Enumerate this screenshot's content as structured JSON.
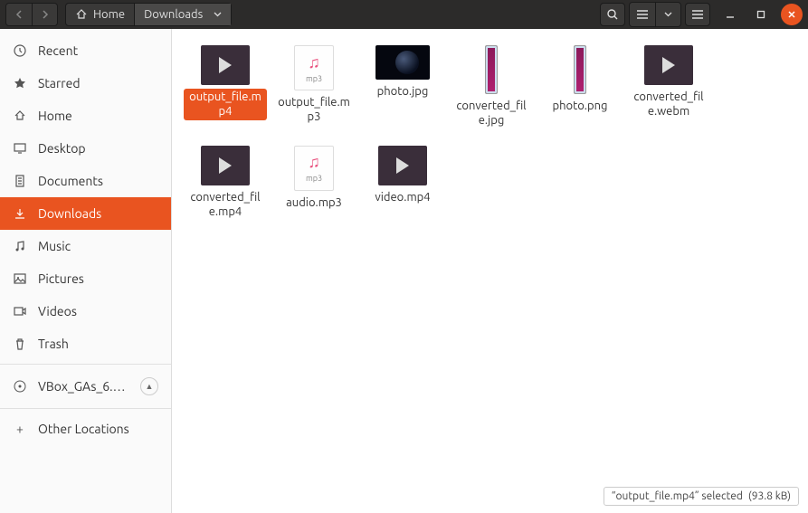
{
  "breadcrumb": {
    "home": "Home",
    "current": "Downloads"
  },
  "sidebar": {
    "items": [
      {
        "label": "Recent",
        "icon": "clock"
      },
      {
        "label": "Starred",
        "icon": "star"
      },
      {
        "label": "Home",
        "icon": "home"
      },
      {
        "label": "Desktop",
        "icon": "desktop"
      },
      {
        "label": "Documents",
        "icon": "documents"
      },
      {
        "label": "Downloads",
        "icon": "downloads",
        "active": true
      },
      {
        "label": "Music",
        "icon": "music"
      },
      {
        "label": "Pictures",
        "icon": "pictures"
      },
      {
        "label": "Videos",
        "icon": "videos"
      },
      {
        "label": "Trash",
        "icon": "trash"
      }
    ],
    "mount": {
      "label": "VBox_GAs_6.…"
    },
    "other": {
      "label": "Other Locations"
    }
  },
  "files": [
    {
      "name": "output_file.mp4",
      "kind": "video",
      "selected": true
    },
    {
      "name": "output_file.mp3",
      "kind": "audio",
      "ext": "mp3"
    },
    {
      "name": "photo.jpg",
      "kind": "photo"
    },
    {
      "name": "converted_file.jpg",
      "kind": "narrow"
    },
    {
      "name": "photo.png",
      "kind": "narrow"
    },
    {
      "name": "converted_file.webm",
      "kind": "video"
    },
    {
      "name": "converted_file.mp4",
      "kind": "video"
    },
    {
      "name": "audio.mp3",
      "kind": "audio",
      "ext": "mp3"
    },
    {
      "name": "video.mp4",
      "kind": "video"
    }
  ],
  "status": {
    "text": "“output_file.mp4” selected",
    "size": "(93.8 kB)"
  }
}
